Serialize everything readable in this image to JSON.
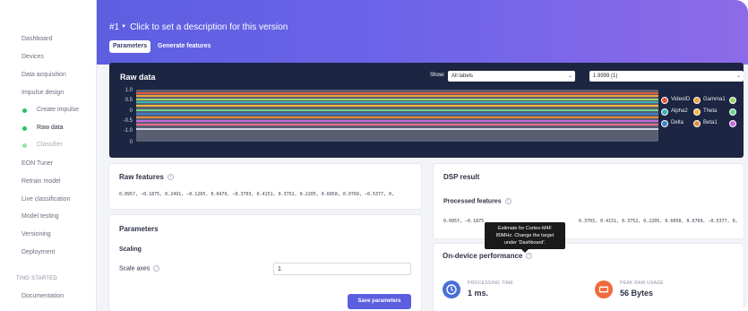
{
  "sidebar": {
    "items": [
      {
        "label": "Dashboard"
      },
      {
        "label": "Devices"
      },
      {
        "label": "Data acquisition"
      },
      {
        "label": "Impulse design"
      },
      {
        "label": "Create impulse"
      },
      {
        "label": "Raw data"
      },
      {
        "label": "Classifier"
      },
      {
        "label": "EON Tuner"
      },
      {
        "label": "Retrain model"
      },
      {
        "label": "Live classification"
      },
      {
        "label": "Model testing"
      },
      {
        "label": "Versioning"
      },
      {
        "label": "Deployment"
      }
    ],
    "section": "TING STARTED",
    "doc_label": "Documentation"
  },
  "header": {
    "version": "#1",
    "description": "Click to set a description for this version",
    "tabs": [
      {
        "label": "Parameters",
        "active": true
      },
      {
        "label": "Generate features",
        "active": false
      }
    ]
  },
  "raw_data": {
    "title": "Raw data",
    "show_label": "Show:",
    "label_filter": "All labels",
    "sample": "1.9999 (1)",
    "y_ticks": [
      "1.0",
      "0.5",
      "0",
      "-0.5",
      "-1.0",
      "0"
    ],
    "legend": [
      {
        "name": "VideoID",
        "color": "#e1573a"
      },
      {
        "name": "Gamma1",
        "color": "#f0a13a"
      },
      {
        "name": "Alpha2",
        "color": "#3ab0b5"
      },
      {
        "name": "Theta",
        "color": "#f5b93a"
      },
      {
        "name": "Delta",
        "color": "#3a7fd0"
      },
      {
        "name": "Beta1",
        "color": "#e58a3a"
      }
    ]
  },
  "raw_features": {
    "title": "Raw features",
    "values": "0.0957, −0.1875, 0.2491, −0.1205, 0.0479, −0.3703, 0.4151, 0.3752, 0.2205, 0.6058, 0.0769, −0.5377, 0,"
  },
  "parameters": {
    "title": "Parameters",
    "section": "Scaling",
    "scale_axes_label": "Scale axes",
    "scale_axes_value": "1",
    "save_label": "Save parameters"
  },
  "dsp_result": {
    "title": "DSP result",
    "processed_label": "Processed features",
    "values": "0.0957, −0.1875",
    "values_tail": "0.3703, 0.4151, 0.3752, 0.2205, 0.6058, 0.0769, −0.5377, 0,"
  },
  "tooltip": {
    "line1": "Estimate for Cortex-M4F",
    "line2": "80MHz. Change the target",
    "line3": "under 'Dashboard'."
  },
  "performance": {
    "title": "On-device performance",
    "processing_label": "PROCESSING TIME",
    "processing_value": "1 ms.",
    "ram_label": "PEAK RAM USAGE",
    "ram_value": "56 Bytes"
  },
  "colors": {
    "accent": "#5c5fe0",
    "panel_bg": "#1c2541",
    "processing_icon": "#4a6fd6",
    "ram_icon": "#f06a3a"
  }
}
